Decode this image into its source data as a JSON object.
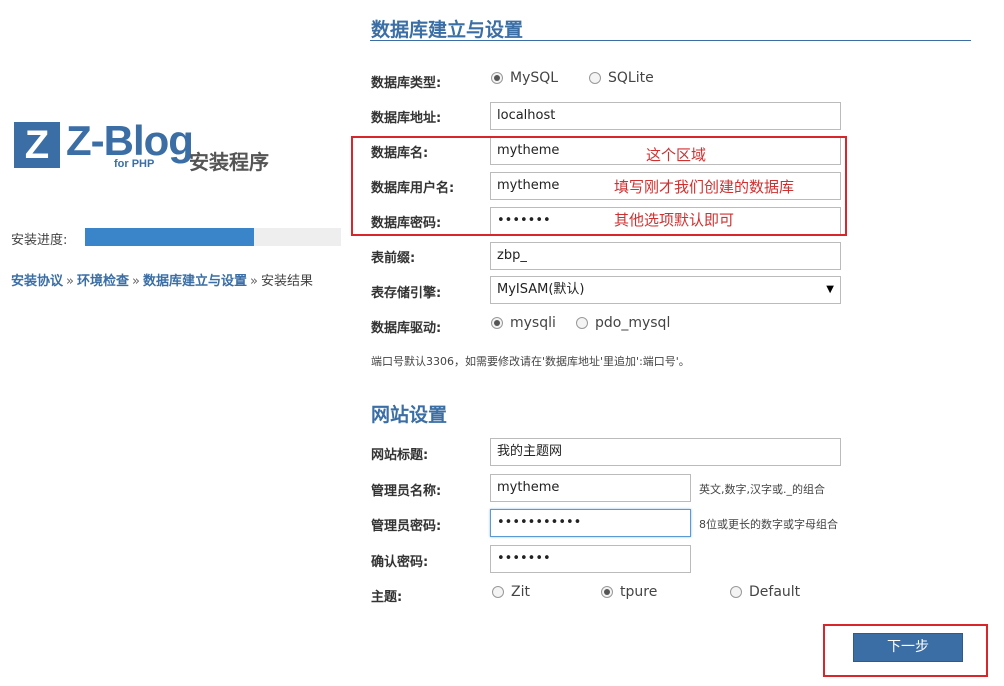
{
  "logo": {
    "mark": "Z",
    "name": "Z-Blog",
    "sub": "for PHP",
    "label": "安装程序"
  },
  "progress": {
    "label": "安装进度:",
    "fraction": 0.66
  },
  "steps": {
    "items": [
      "安装协议",
      "环境检查",
      "数据库建立与设置",
      "安装结果"
    ],
    "separator": "»"
  },
  "database": {
    "title": "数据库建立与设置",
    "type_label": "数据库类型:",
    "type_options": [
      "MySQL",
      "SQLite"
    ],
    "type_selected": "MySQL",
    "host_label": "数据库地址:",
    "host_value": "localhost",
    "name_label": "数据库名:",
    "name_value": "mytheme",
    "user_label": "数据库用户名:",
    "user_value": "mytheme",
    "password_label": "数据库密码:",
    "password_value": "•••••••",
    "prefix_label": "表前缀:",
    "prefix_value": "zbp_",
    "engine_label": "表存储引擎:",
    "engine_value": "MyISAM(默认)",
    "driver_label": "数据库驱动:",
    "driver_options": [
      "mysqli",
      "pdo_mysql"
    ],
    "driver_selected": "mysqli",
    "port_hint": "端口号默认3306，如需要修改请在'数据库地址'里追加':端口号'。"
  },
  "annotations": {
    "line1": "这个区域",
    "line2": "填写刚才我们创建的数据库",
    "line3": "其他选项默认即可"
  },
  "site": {
    "title": "网站设置",
    "site_title_label": "网站标题:",
    "site_title_value": "我的主题网",
    "admin_name_label": "管理员名称:",
    "admin_name_value": "mytheme",
    "admin_name_hint": "英文,数字,汉字或._的组合",
    "admin_pwd_label": "管理员密码:",
    "admin_pwd_value": "•••••••••••",
    "admin_pwd_hint": "8位或更长的数字或字母组合",
    "confirm_label": "确认密码:",
    "confirm_value": "•••••••",
    "theme_label": "主题:",
    "theme_options": [
      "Zit",
      "tpure",
      "Default"
    ],
    "theme_selected": "tpure"
  },
  "next_button": "下一步",
  "colors": {
    "accent": "#3a6ea5",
    "progress": "#3a84c9",
    "annotation": "#d9262b"
  }
}
